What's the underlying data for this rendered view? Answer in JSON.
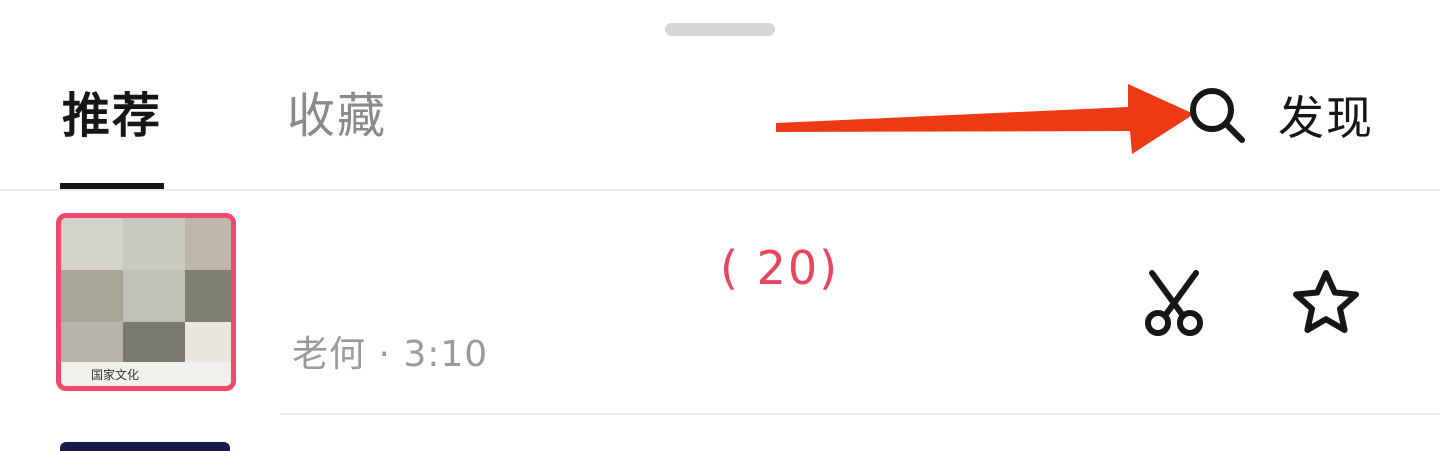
{
  "header": {
    "tabs": [
      {
        "label": "推荐",
        "active": true
      },
      {
        "label": "收藏",
        "active": false
      }
    ],
    "discover_label": "发现",
    "search_icon": "search-icon"
  },
  "song": {
    "title": "(  20)",
    "meta": "老何 · 3:10",
    "thumbnail_caption": "国家文化",
    "actions": [
      "scissors-icon",
      "star-icon"
    ]
  },
  "colors": {
    "accent": "#ee4a6d",
    "title": "#e8445e",
    "arrow": "#ee3a14",
    "text": "#161616",
    "muted": "#8a8a8a"
  }
}
